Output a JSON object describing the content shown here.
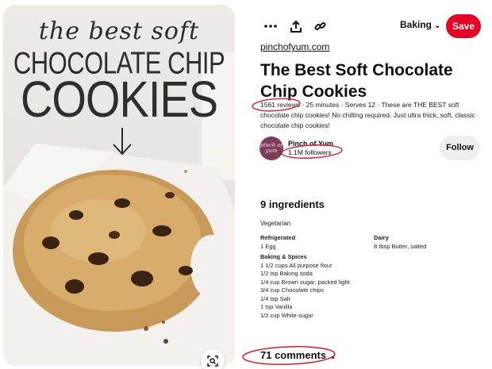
{
  "image": {
    "title_script": "the best soft",
    "title_line1": "CHOCOLATE CHIP",
    "title_line2": "COOKIES"
  },
  "toolbar": {
    "more_icon": "more-dots-icon",
    "share_icon": "share-upload-icon",
    "link_icon": "link-icon",
    "board_name": "Baking",
    "save_label": "Save"
  },
  "source_link": "pinchofyum.com",
  "title": "The Best Soft Chocolate Chip Cookies",
  "description": "1561 reviews · 25 minutes · Serves 12 · These are THE BEST soft chocolate chip cookies! No chilling required. Just ultra thick, soft, classic chocolate chip cookies!",
  "creator": {
    "avatar_text": "pinch of yum",
    "name": "Pinch of Yum",
    "followers": "1.1M followers",
    "follow_label": "Follow"
  },
  "ingredients": {
    "heading": "9 ingredients",
    "diet": "Vegetarian",
    "groups_left": [
      {
        "category": "Refrigerated",
        "items": [
          "1 Egg"
        ]
      },
      {
        "category": "Baking & Spices",
        "items": [
          "1 1/2 cups All purpose flour",
          "1/2 tsp Baking soda",
          "1/4 cup Brown sugar, packed light",
          "3/4 cup Chocolate chips",
          "1/4 tsp Salt",
          "1 tsp Vanilla",
          "1/2 cup White sugar"
        ]
      }
    ],
    "groups_right": [
      {
        "category": "Dairy",
        "items": [
          "8 tbsp Butter, salted"
        ]
      }
    ]
  },
  "comments": {
    "label": "71 comments"
  },
  "colors": {
    "save_red": "#e60023",
    "annotation_red": "#d61f2c",
    "avatar": "#7a3c57"
  }
}
